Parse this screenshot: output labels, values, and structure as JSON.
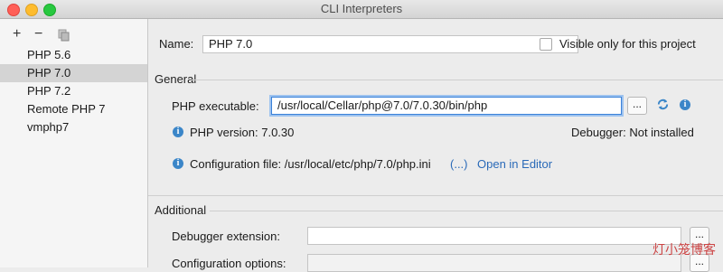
{
  "window": {
    "title": "CLI Interpreters"
  },
  "toolbar": {
    "add": "+",
    "remove": "−",
    "copy_icon": "copy-icon"
  },
  "interpreters": [
    "PHP 5.6",
    "PHP 7.0",
    "PHP 7.2",
    "Remote PHP 7",
    "vmphp7"
  ],
  "selected_index": 1,
  "form": {
    "name_label": "Name:",
    "name_value": "PHP 7.0",
    "visible_label": "Visible only for this project",
    "general_section": "General",
    "php_exec_label": "PHP executable:",
    "php_exec_value": "/usr/local/Cellar/php@7.0/7.0.30/bin/php",
    "browse_label": "...",
    "php_version_text": "PHP version: 7.0.30",
    "debugger_text": "Debugger: Not installed",
    "config_file_text": "Configuration file: /usr/local/etc/php/7.0/php.ini",
    "config_more": "(...)",
    "open_in_editor": "Open in Editor",
    "additional_section": "Additional",
    "debugger_ext_label": "Debugger extension:",
    "config_options_label": "Configuration options:"
  },
  "watermark": "灯小笼博客",
  "colors": {
    "accent": "#3b82d9",
    "link": "#2a6ab8",
    "info": "#3b86c8"
  }
}
